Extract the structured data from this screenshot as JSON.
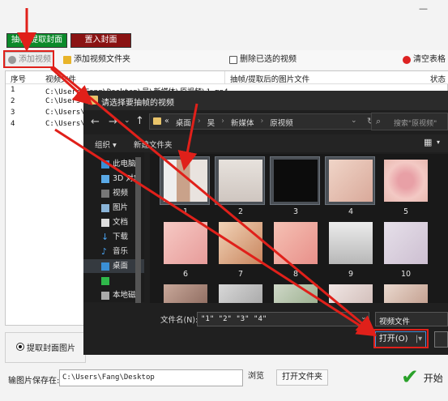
{
  "app": {
    "tabs": [
      {
        "label": "抽帧/提取封面",
        "color": "#0b8a2a"
      },
      {
        "label": "置入封面",
        "color": "#8a1212"
      }
    ],
    "toolbar": {
      "add_video": "添加视频",
      "add_folder": "添加视频文件夹",
      "delete_selected": "删除已选的视频",
      "clear_table": "清空表格"
    },
    "table": {
      "headers": [
        "序号",
        "视频文件",
        "抽帧/提取后的图片文件",
        "状态"
      ],
      "rows": [
        {
          "num": "1",
          "path": "C:\\Users\\Fang\\Desktop\\吴\\新媒体\\原视频\\1.mp4"
        },
        {
          "num": "2",
          "path": "C:\\Users\\Fang\\De"
        },
        {
          "num": "3",
          "path": "C:\\Users\\Fang\\De"
        },
        {
          "num": "4",
          "path": "C:\\Users\\Fang\\De"
        }
      ]
    },
    "option_radio": "提取封面图片",
    "save_label": "输图片保存在:",
    "save_path": "C:\\Users\\Fang\\Desktop",
    "browse": "浏览",
    "open_folder": "打开文件夹",
    "start": "开始"
  },
  "dialog": {
    "title": "请选择要抽帧的视频",
    "breadcrumb": [
      "«",
      "桌面",
      "吴",
      "新媒体",
      "原视频"
    ],
    "search_placeholder": "搜索\"原视频\"",
    "organize": "组织 ▾",
    "new_folder": "新建文件夹",
    "nav_items": [
      "此电脑",
      "3D 对象",
      "视频",
      "图片",
      "文档",
      "下载",
      "音乐",
      "桌面",
      "",
      "本地磁"
    ],
    "thumbnails": [
      "1",
      "2",
      "3",
      "4",
      "5",
      "6",
      "7",
      "8",
      "9",
      "10",
      "",
      "",
      "",
      "",
      ""
    ],
    "filename_label": "文件名(N):",
    "filename_value": "\"1\" \"2\" \"3\" \"4\"",
    "filetype": "视频文件",
    "open": "打开(O)",
    "cancel": ""
  },
  "colors": {
    "annotation_red": "#e0201a",
    "start_green": "#2aa12a"
  }
}
